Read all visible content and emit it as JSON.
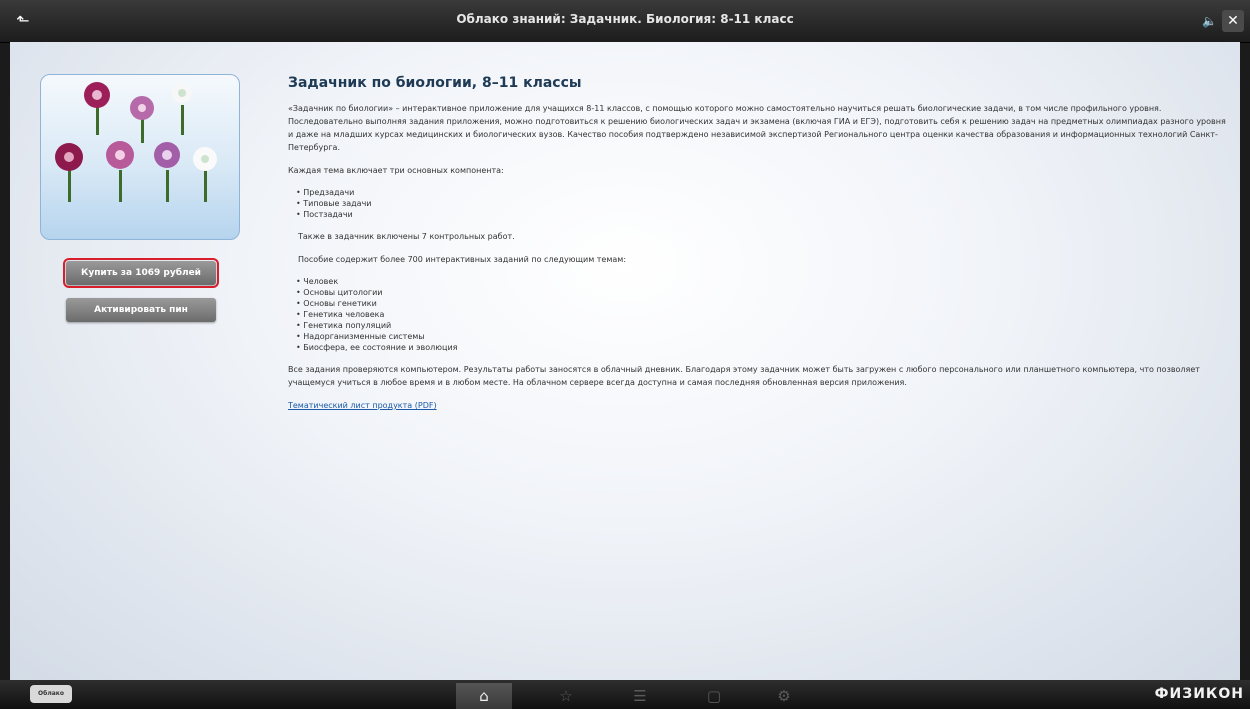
{
  "window": {
    "title": "Облако знаний: Задачник. Биология: 8-11 класс"
  },
  "sidebar": {
    "buy_button": "Купить за 1069 рублей",
    "activate_button": "Активировать пин"
  },
  "main": {
    "heading": "Задачник по биологии, 8–11 классы",
    "intro": "«Задачник по биологии» – интерактивное приложение для учащихся 8-11 классов, с помощью которого можно самостоятельно научиться решать биологические задачи, в том числе профильного уровня. Последовательно выполняя задания приложения, можно подготовиться к решению биологических задач и экзамена (включая ГИА и ЕГЭ), подготовить себя к решению задач на предметных олимпиадах разного уровня и даже на младших курсах медицинских и биологических вузов. Качество пособия подтверждено независимой экспертизой Регионального центра оценки качества образования и информационных технологий Санкт-Петербурга.",
    "components_intro": "Каждая тема включает три основных компонента:",
    "components": [
      "Предзадачи",
      "Типовые задачи",
      "Постзадачи"
    ],
    "control_works": "Также в задачник включены 7 контрольных работ.",
    "tasks_intro": "Пособие содержит более 700 интерактивных заданий по следующим темам:",
    "topics": [
      "Человек",
      "Основы цитологии",
      "Основы генетики",
      "Генетика человека",
      "Генетика популяций",
      "Надорганизменные системы",
      "Биосфера, ее состояние и эволюция"
    ],
    "closing": "Все задания проверяются компьютером. Результаты работы заносятся в облачный дневник. Благодаря этому задачник может быть загружен с любого персонального или планшетного компьютера, что позволяет учащемуся учиться в любое время и в любом месте. На облачном сервере всегда доступна и самая последняя обновленная версия приложения.",
    "pdf_link": "Тематический лист продукта (PDF)"
  },
  "bottombar": {
    "left_logo": "Облако",
    "brand": "ФИЗИКОН",
    "tabs": [
      {
        "icon": "home-icon",
        "active": true
      },
      {
        "icon": "star-icon",
        "active": false
      },
      {
        "icon": "list-icon",
        "active": false
      },
      {
        "icon": "window-icon",
        "active": false
      },
      {
        "icon": "gear-icon",
        "active": false
      }
    ]
  },
  "colors": {
    "accent_outline": "#d81e2a",
    "heading": "#1f3a55",
    "link": "#1a5aa8"
  }
}
